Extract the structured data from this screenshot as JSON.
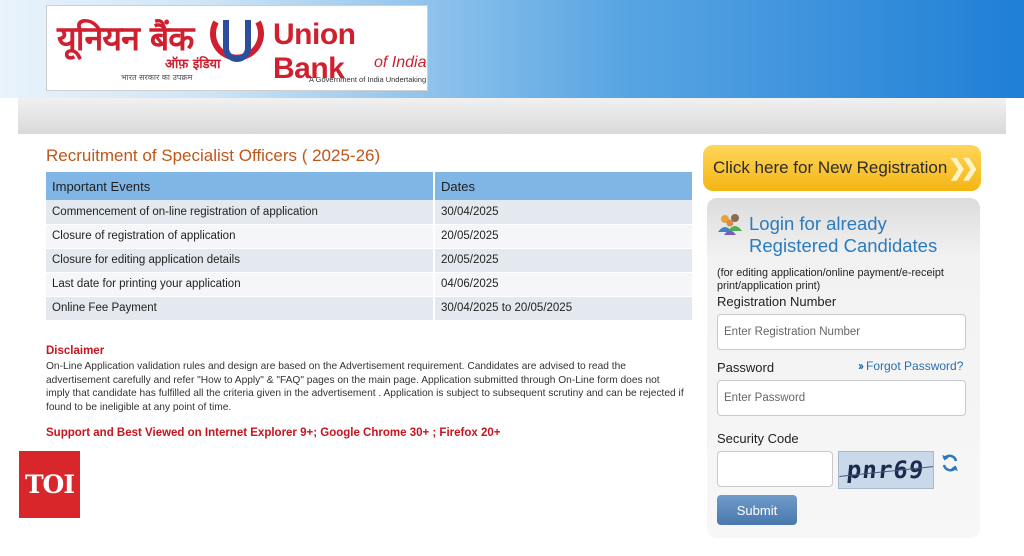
{
  "brand": {
    "hindi_name": "यूनियन बैंक",
    "hindi_sub": "ऑफ़ इंडिया",
    "hindi_tagline": "भारत सरकार का उपक्रम",
    "english_name": "Union Bank",
    "english_sub": "of India",
    "english_tagline": "A Government of India Undertaking",
    "color": "#d01f2e"
  },
  "main": {
    "title": "Recruitment of Specialist Officers ( 2025-26)",
    "table": {
      "headers": [
        "Important Events",
        "Dates"
      ],
      "rows": [
        [
          "Commencement of on-line registration of application",
          "30/04/2025"
        ],
        [
          "Closure of registration of application",
          "20/05/2025"
        ],
        [
          "Closure for editing application details",
          "20/05/2025"
        ],
        [
          "Last date for printing your application",
          "04/06/2025"
        ],
        [
          "Online Fee Payment",
          "30/04/2025 to 20/05/2025"
        ]
      ]
    },
    "disclaimer_heading": "Disclaimer",
    "disclaimer_text": "On-Line Application validation rules and design are based on the Advertisement requirement. Candidates are advised to read the advertisement carefully and refer \"How to Apply\" & \"FAQ\" pages on the main page. Application submitted through On-Line form does not imply that candidate has fulfilled all the criteria given in the advertisement . Application is subject to subsequent scrutiny and can be rejected if found to be ineligible at any point of time.",
    "support_text": "Support and Best Viewed on Internet Explorer 9+; Google Chrome 30+ ; Firefox 20+"
  },
  "sidebar": {
    "new_registration_label": "Click here for New Registration",
    "new_registration_icon": "double-chevron-right-icon",
    "login_icon": "users-icon",
    "login_title": "Login for already Registered Candidates",
    "login_note": "(for editing application/online payment/e-receipt print/application print)",
    "registration_label": "Registration Number",
    "registration_placeholder": "Enter Registration Number",
    "password_label": "Password",
    "password_placeholder": "Enter Password",
    "forgot_password": "Forgot Password?",
    "security_label": "Security Code",
    "captcha_text": "pnr69",
    "refresh_icon": "refresh-icon",
    "submit_label": "Submit"
  },
  "watermark": {
    "label": "TOI",
    "color": "#d8262b"
  }
}
